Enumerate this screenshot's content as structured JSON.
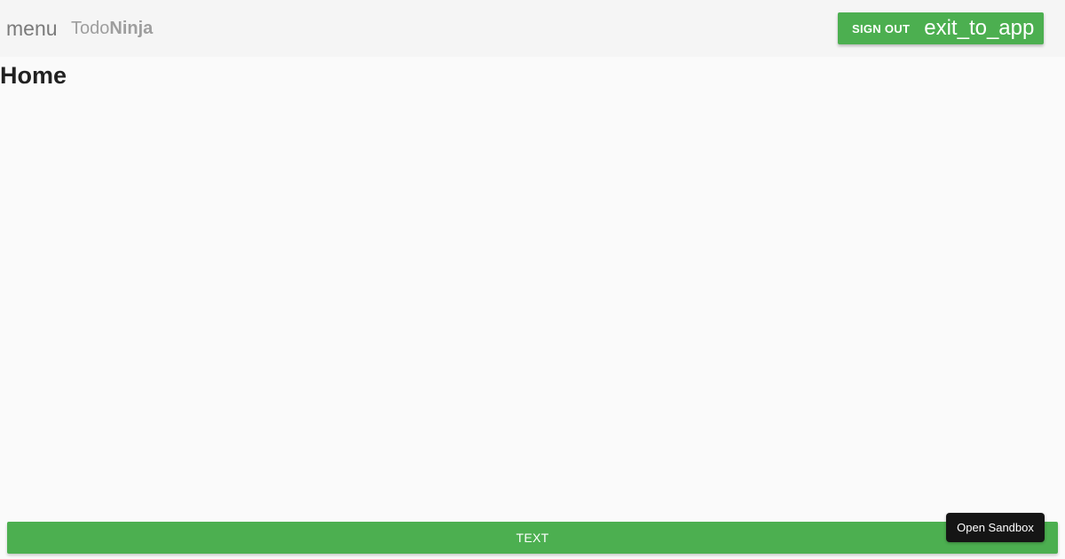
{
  "toolbar": {
    "menu_icon_text": "menu",
    "brand_light": "Todo",
    "brand_bold": "Ninja",
    "signout_label": "SIGN OUT",
    "exit_icon_text": "exit_to_app"
  },
  "main": {
    "title": "Home"
  },
  "footer": {
    "text_button_label": "TEXT",
    "sandbox_button_label": "Open Sandbox"
  },
  "colors": {
    "accent": "#4caf50",
    "toolbar_bg": "#f5f5f5",
    "page_bg": "#fafafa",
    "sandbox_bg": "#151515"
  }
}
